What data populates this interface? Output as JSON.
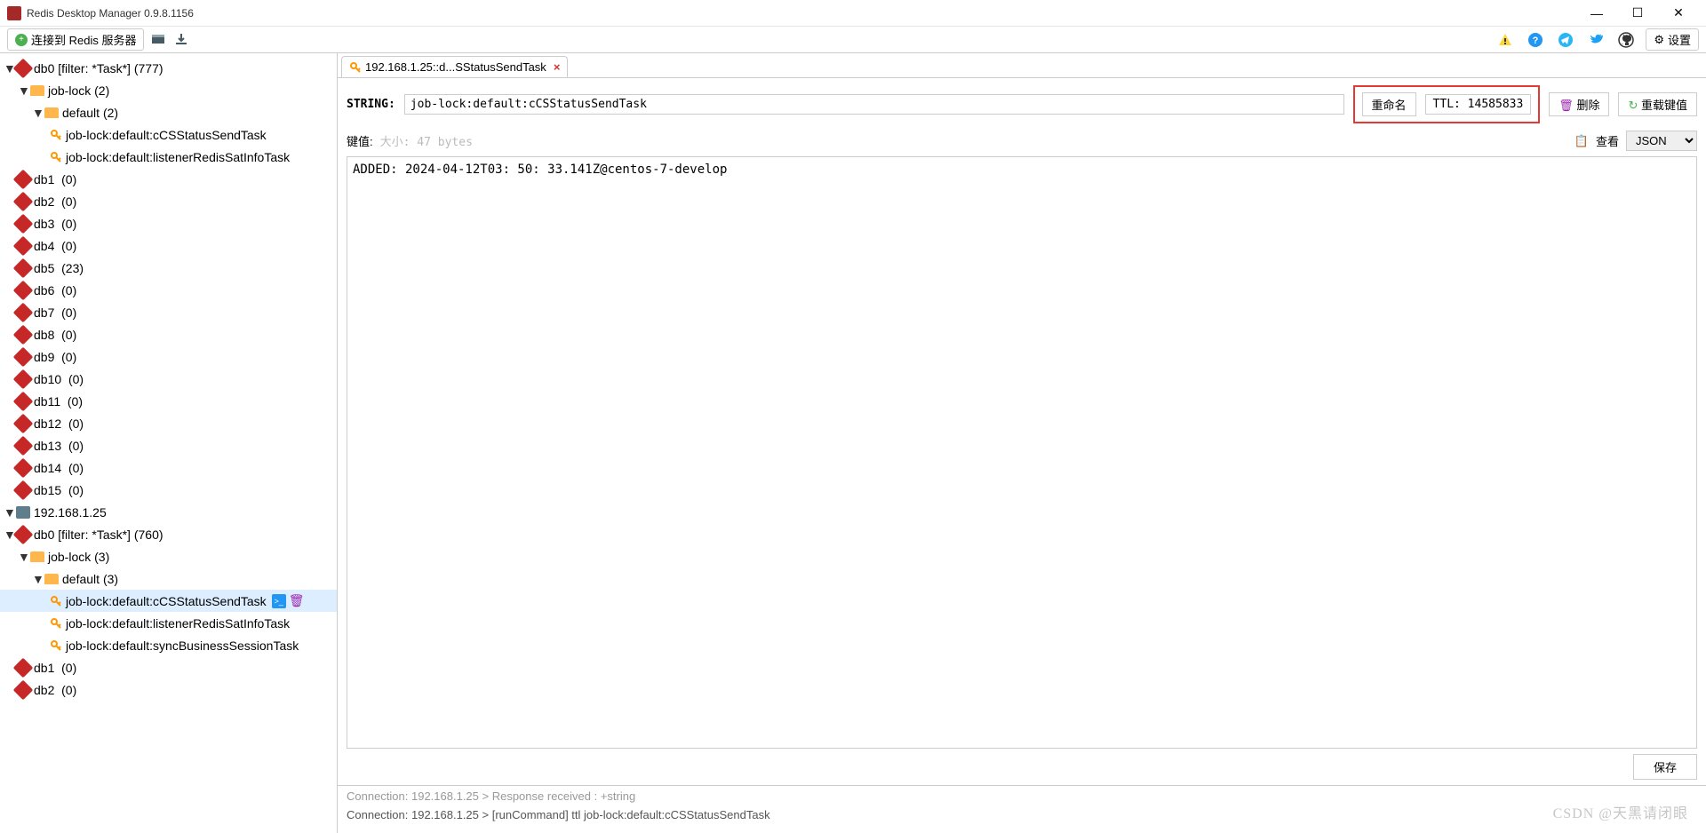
{
  "title": "Redis Desktop Manager 0.9.8.1156",
  "toolbar": {
    "connect": "连接到 Redis 服务器",
    "settings": "设置"
  },
  "sidebar": {
    "server1": {
      "db0": {
        "label": "db0",
        "filter": "[filter: *Task*]",
        "count": "(777)"
      },
      "joblock": {
        "label": "job-lock",
        "count": "(2)"
      },
      "default": {
        "label": "default",
        "count": "(2)"
      },
      "keys1": [
        "job-lock:default:cCSStatusSendTask",
        "job-lock:default:listenerRedisSatInfoTask"
      ],
      "dbs": [
        {
          "name": "db1",
          "count": "(0)"
        },
        {
          "name": "db2",
          "count": "(0)"
        },
        {
          "name": "db3",
          "count": "(0)"
        },
        {
          "name": "db4",
          "count": "(0)"
        },
        {
          "name": "db5",
          "count": "(23)"
        },
        {
          "name": "db6",
          "count": "(0)"
        },
        {
          "name": "db7",
          "count": "(0)"
        },
        {
          "name": "db8",
          "count": "(0)"
        },
        {
          "name": "db9",
          "count": "(0)"
        },
        {
          "name": "db10",
          "count": "(0)"
        },
        {
          "name": "db11",
          "count": "(0)"
        },
        {
          "name": "db12",
          "count": "(0)"
        },
        {
          "name": "db13",
          "count": "(0)"
        },
        {
          "name": "db14",
          "count": "(0)"
        },
        {
          "name": "db15",
          "count": "(0)"
        }
      ]
    },
    "server2": {
      "host": "192.168.1.25",
      "db0": {
        "label": "db0",
        "filter": "[filter: *Task*]",
        "count": "(760)"
      },
      "joblock": {
        "label": "job-lock",
        "count": "(3)"
      },
      "default": {
        "label": "default",
        "count": "(3)"
      },
      "keys": [
        "job-lock:default:cCSStatusSendTask",
        "job-lock:default:listenerRedisSatInfoTask",
        "job-lock:default:syncBusinessSessionTask"
      ],
      "dbs_tail": [
        {
          "name": "db1",
          "count": "(0)"
        },
        {
          "name": "db2",
          "count": "(0)"
        }
      ]
    }
  },
  "tab": {
    "label": "192.168.1.25::d...SStatusSendTask"
  },
  "detail": {
    "type": "STRING:",
    "key": "job-lock:default:cCSStatusSendTask",
    "rename": "重命名",
    "ttl": "TTL: 14585833",
    "delete": "删除",
    "reload": "重载键值",
    "valuelabel": "键值:",
    "sizehint": "大小: 47 bytes",
    "view": "查看",
    "format": "JSON",
    "value": "ADDED: 2024-04-12T03: 50: 33.141Z@centos-7-develop",
    "save": "保存"
  },
  "log": {
    "line1": "Connection: 192.168.1.25 > Response received : +string",
    "line2": "Connection: 192.168.1.25 > [runCommand] ttl job-lock:default:cCSStatusSendTask"
  },
  "watermark": "CSDN @天黑请闭眼"
}
